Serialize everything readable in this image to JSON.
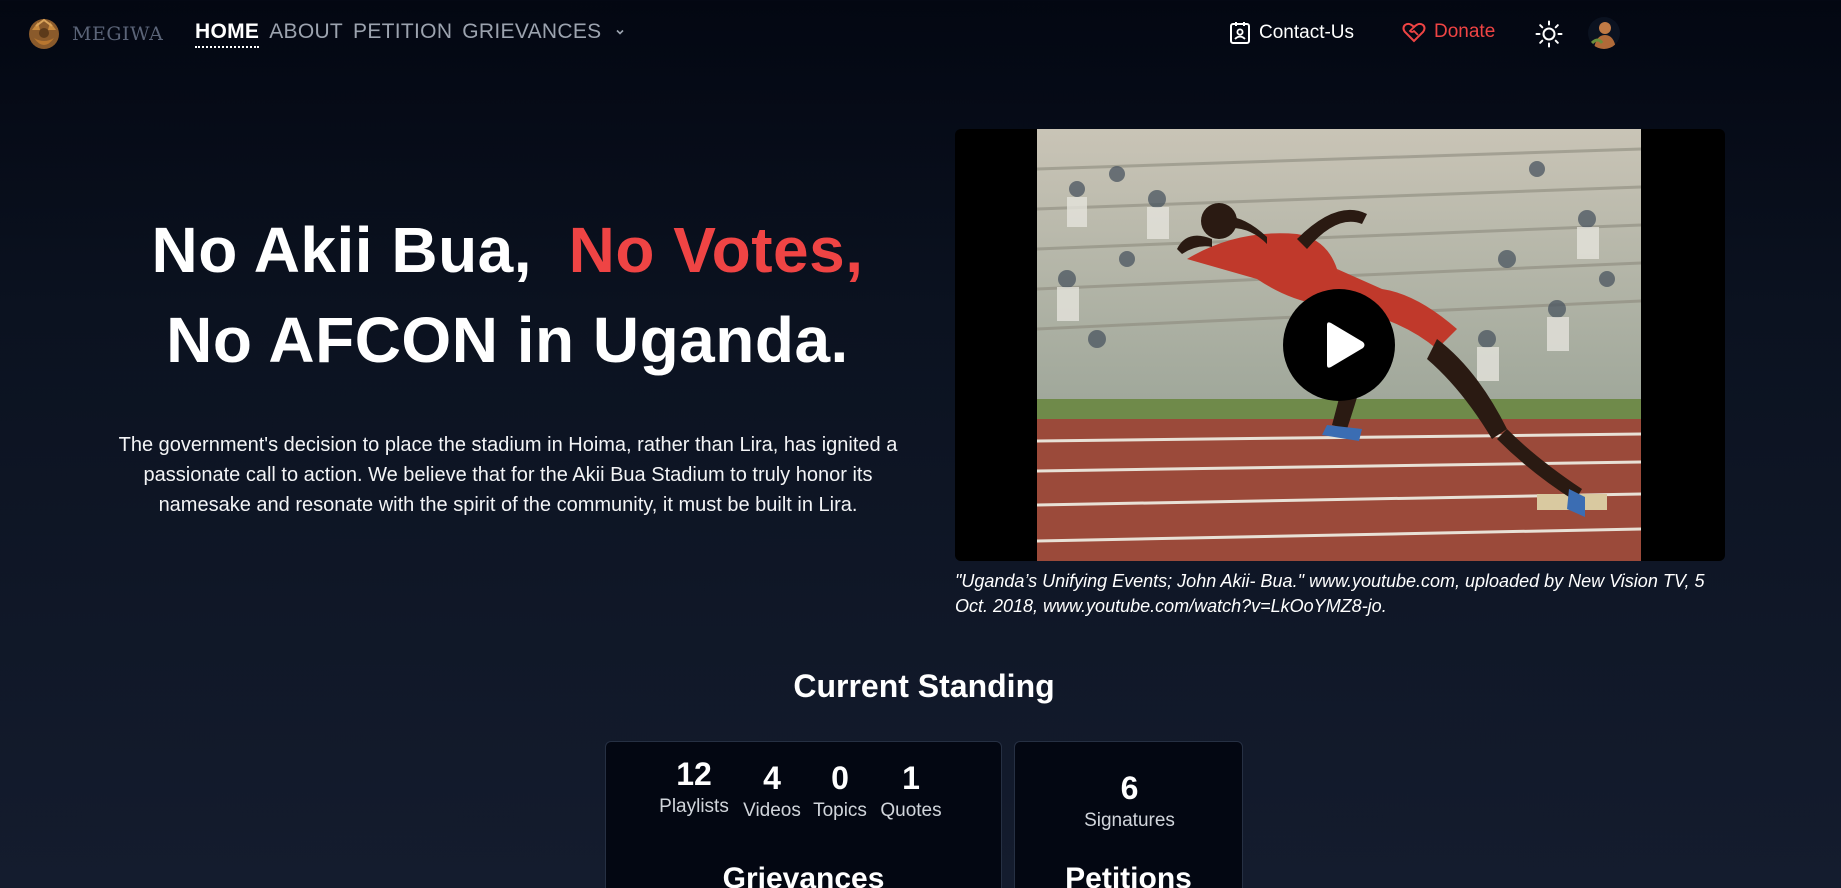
{
  "header": {
    "logo_text": "MEGIWA",
    "nav": [
      {
        "label": "HOME",
        "active": true
      },
      {
        "label": "ABOUT",
        "active": false
      },
      {
        "label": "PETITION",
        "active": false
      },
      {
        "label": "GRIEVANCES",
        "active": false,
        "has_dropdown": true
      }
    ],
    "contact_label": "Contact-Us",
    "donate_label": "Donate",
    "icons": {
      "contact": "contact-card-icon",
      "donate": "heart-handshake-icon",
      "theme": "sun-icon",
      "dropdown": "chevron-down-icon"
    }
  },
  "hero": {
    "title_part1": "No Akii Bua,",
    "title_part2": "No Votes,",
    "title_line2": "No AFCON in Uganda.",
    "description": "The government's decision to place the stadium in Hoima, rather than Lira, has ignited a passionate call to action. We believe that for the Akii Bua Stadium to truly honor its namesake and resonate with the spirit of the community, it must be built in Lira."
  },
  "video": {
    "caption": "\"Uganda’s Unifying Events; John Akii- Bua.\" www.youtube.com, uploaded by New Vision TV, 5 Oct. 2018, www.youtube.com/watch?v=LkOoYMZ8-jo."
  },
  "standing": {
    "title": "Current Standing",
    "grievances": {
      "stats": [
        {
          "value": "12",
          "label": "Playlists"
        },
        {
          "value": "4",
          "label": "Videos"
        },
        {
          "value": "0",
          "label": "Topics"
        },
        {
          "value": "1",
          "label": "Quotes"
        }
      ],
      "heading": "Grievances"
    },
    "petitions": {
      "stats": [
        {
          "value": "6",
          "label": "Signatures"
        }
      ],
      "heading": "Petitions"
    }
  },
  "colors": {
    "accent_red": "#ef4444",
    "background_top": "#030712",
    "background_bottom": "#141c2e",
    "nav_inactive": "#9ca3af"
  }
}
